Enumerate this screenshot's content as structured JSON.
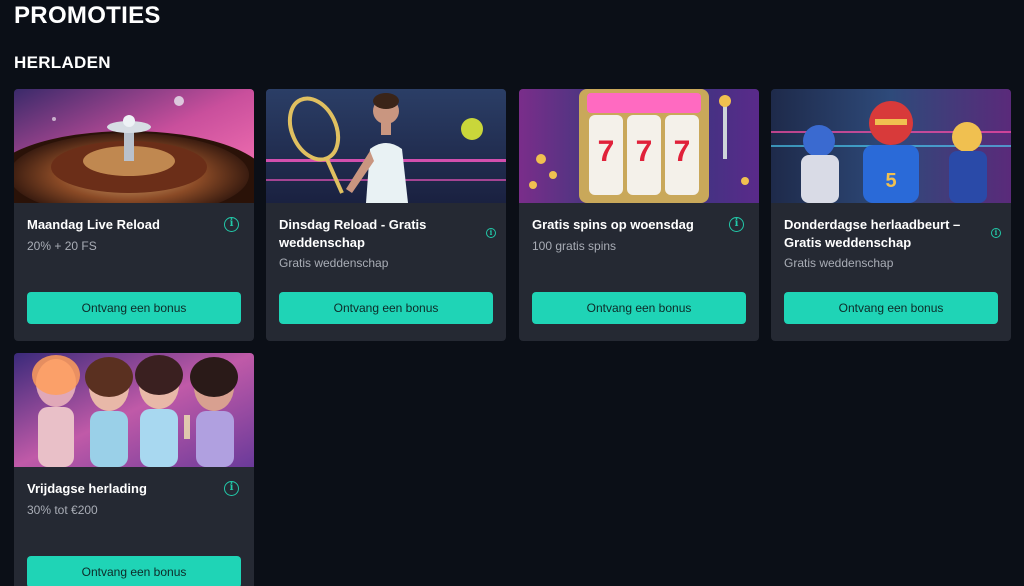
{
  "page": {
    "title": "PROMOTIES"
  },
  "section": {
    "title": "HERLADEN"
  },
  "cards": [
    {
      "title": "Maandag Live Reload",
      "subtitle": "20% + 20 FS",
      "button": "Ontvang een bonus",
      "image": "roulette-wheel"
    },
    {
      "title": "Dinsdag Reload - Gratis weddenschap",
      "subtitle": "Gratis weddenschap",
      "button": "Ontvang een bonus",
      "image": "tennis-player"
    },
    {
      "title": "Gratis spins op woensdag",
      "subtitle": "100 gratis spins",
      "button": "Ontvang een bonus",
      "image": "slot-machine"
    },
    {
      "title": "Donderdagse herlaadbeurt – Gratis weddenschap",
      "subtitle": "Gratis weddenschap",
      "button": "Ontvang een bonus",
      "image": "football-players"
    },
    {
      "title": "Vrijdagse herlading",
      "subtitle": "30% tot €200",
      "button": "Ontvang een bonus",
      "image": "party-women"
    }
  ],
  "colors": {
    "background": "#0b0f17",
    "card": "#252933",
    "accent": "#1fd4b6",
    "muted_text": "#a9adb6"
  },
  "icons": {
    "info": "info-icon",
    "info_glyph": "i"
  }
}
